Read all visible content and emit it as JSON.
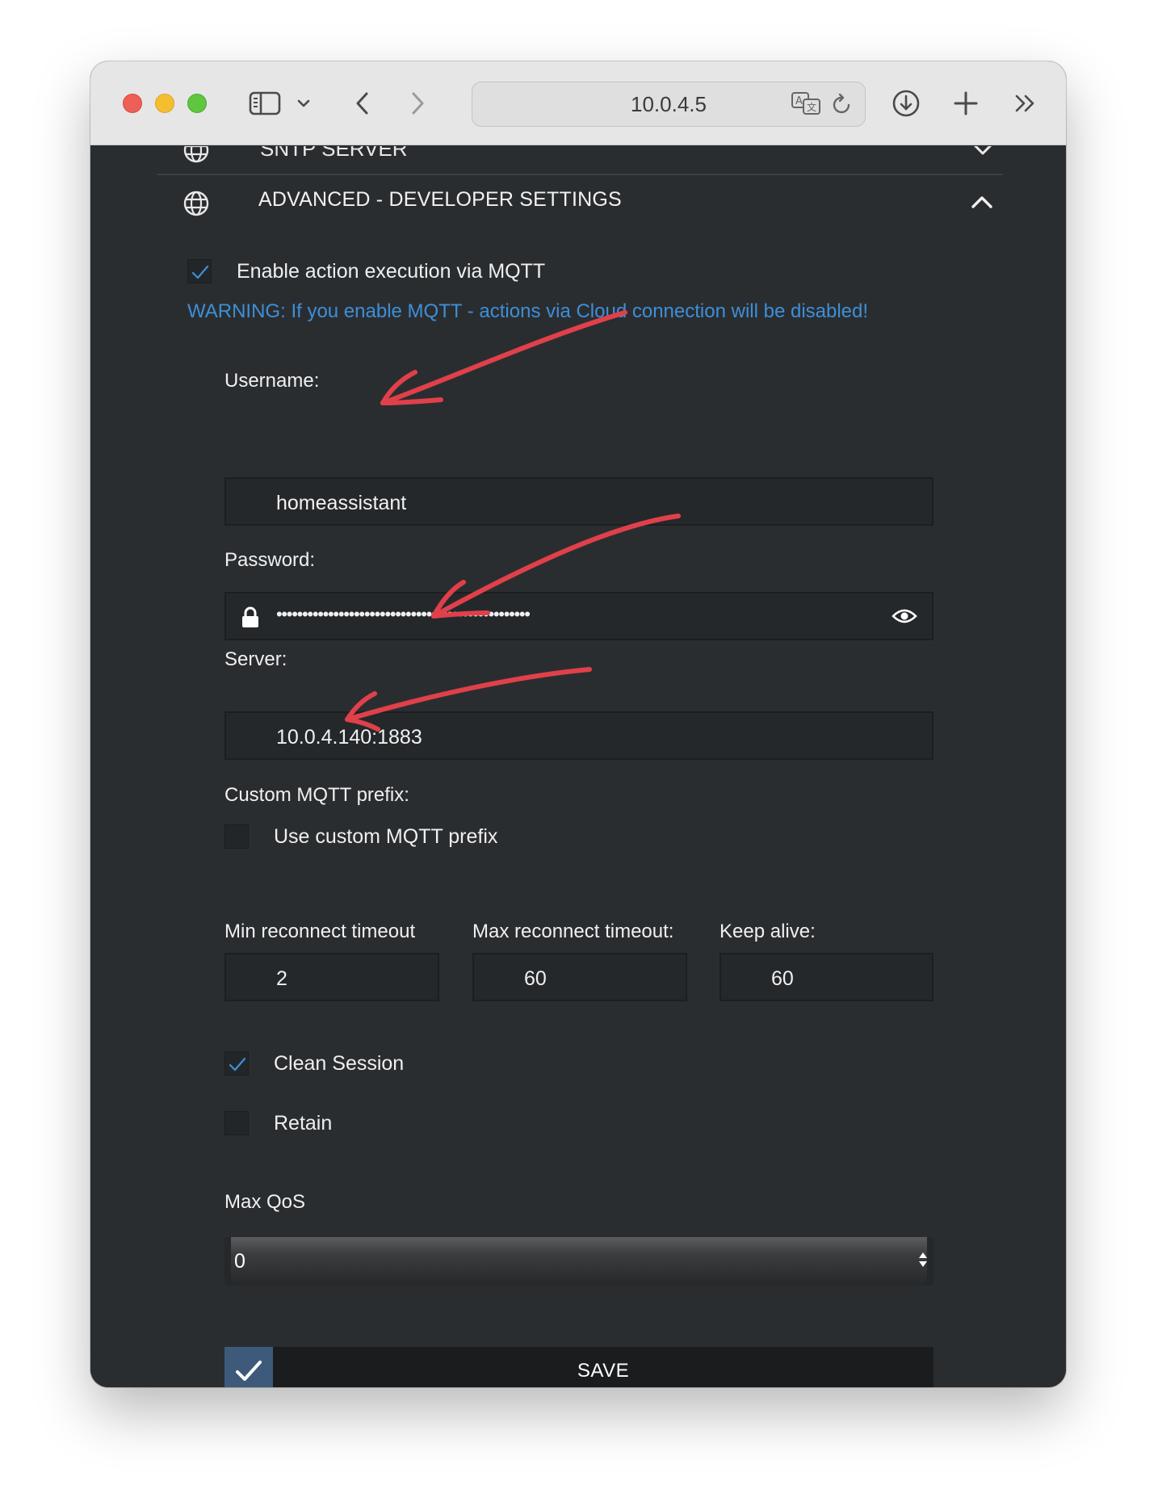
{
  "browser": {
    "address": "10.0.4.5"
  },
  "section_above": {
    "label": "SNTP SERVER"
  },
  "accordion": {
    "title": "ADVANCED - DEVELOPER SETTINGS"
  },
  "mqtt": {
    "enable_label": "Enable action execution via MQTT",
    "enable_checked": true,
    "warning": "WARNING: If you enable MQTT - actions via Cloud connection will be disabled!",
    "username_label": "Username:",
    "username_value": "homeassistant",
    "password_label": "Password:",
    "password_value": "•••••••••••••••••••••••••••••••••••••••••••••••••",
    "server_label": "Server:",
    "server_value": "10.0.4.140:1883",
    "prefix_label": "Custom MQTT prefix:",
    "prefix_checkbox_label": "Use custom MQTT prefix",
    "prefix_checked": false,
    "min_reconnect_label": "Min reconnect timeout",
    "min_reconnect_value": "2",
    "max_reconnect_label": "Max reconnect timeout:",
    "max_reconnect_value": "60",
    "keep_alive_label": "Keep alive:",
    "keep_alive_value": "60",
    "clean_session_label": "Clean Session",
    "clean_session_checked": true,
    "retain_label": "Retain",
    "retain_checked": false,
    "max_qos_label": "Max QoS",
    "max_qos_value": "0",
    "save_label": "SAVE"
  },
  "colors": {
    "background": "#2a2d30",
    "input_bg": "#25282b",
    "warning": "#3d8fd8",
    "save_check_bg": "#3d5a7b",
    "annotation_arrow": "#e0404a"
  },
  "icons": {
    "section_icon": "globe-icon",
    "collapse_icon": "chevron-up-icon",
    "password_prefix": "lock-icon",
    "password_toggle": "eye-icon",
    "save_icon": "checkmark-icon"
  }
}
